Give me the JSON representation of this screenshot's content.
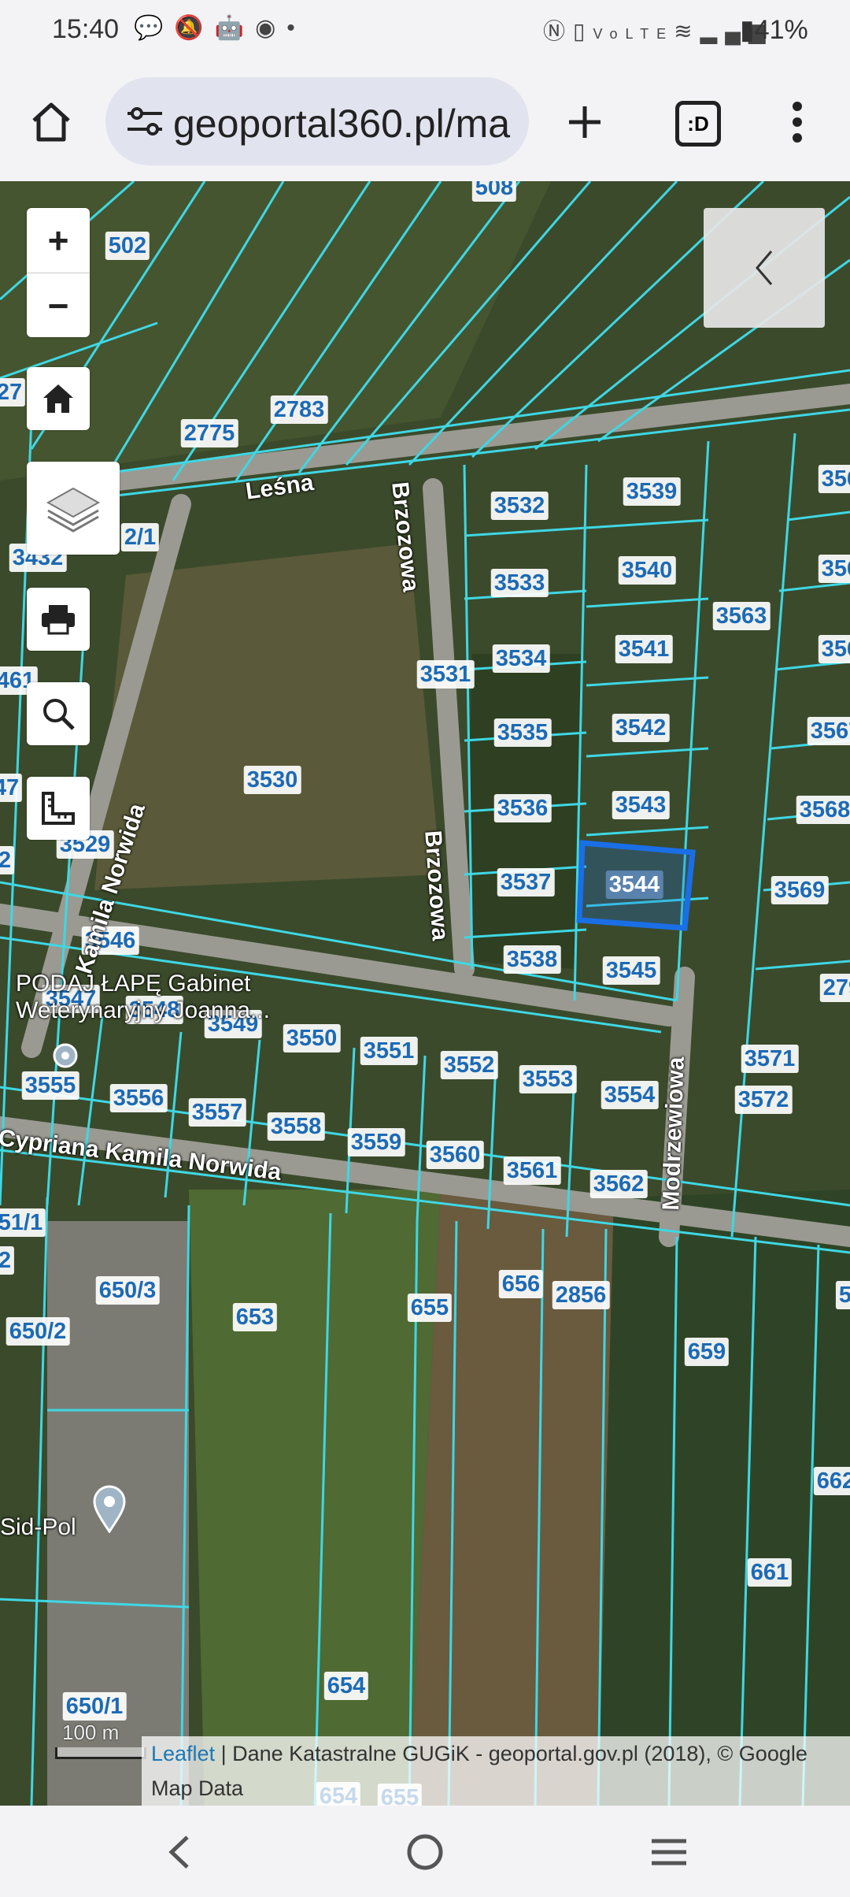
{
  "status": {
    "time": "15:40",
    "left_icons": [
      "chat-icon",
      "bell-off-icon",
      "android-icon",
      "chrome-icon",
      "dot-icon"
    ],
    "right_icons": [
      "nfc-icon",
      "vibrate-icon",
      "volte-icon",
      "wifi-icon",
      "signal-icon"
    ],
    "battery": "41%"
  },
  "browser": {
    "url": "geoportal360.pl/ma",
    "tab_label": ":D"
  },
  "map": {
    "colors": {
      "parcel_line": "#3fd7e4",
      "selected": "#1a6fe6",
      "label_text": "#1d6ab5"
    },
    "selected_parcel": "3544",
    "parcels": [
      {
        "id": "508"
      },
      {
        "id": "502"
      },
      {
        "id": "27"
      },
      {
        "id": "2783"
      },
      {
        "id": "2775"
      },
      {
        "id": "2/1"
      },
      {
        "id": "3432"
      },
      {
        "id": "3532"
      },
      {
        "id": "3539"
      },
      {
        "id": "3533"
      },
      {
        "id": "3540"
      },
      {
        "id": "3563"
      },
      {
        "id": "3534"
      },
      {
        "id": "3541"
      },
      {
        "id": "3531"
      },
      {
        "id": "3535"
      },
      {
        "id": "3542"
      },
      {
        "id": "3530"
      },
      {
        "id": "3536"
      },
      {
        "id": "3543"
      },
      {
        "id": "3537"
      },
      {
        "id": "3544"
      },
      {
        "id": "3569"
      },
      {
        "id": "3529"
      },
      {
        "id": "3538"
      },
      {
        "id": "3545"
      },
      {
        "id": "3546"
      },
      {
        "id": "3547"
      },
      {
        "id": "3548"
      },
      {
        "id": "3549"
      },
      {
        "id": "3550"
      },
      {
        "id": "3551"
      },
      {
        "id": "3552"
      },
      {
        "id": "3553"
      },
      {
        "id": "3554"
      },
      {
        "id": "3571"
      },
      {
        "id": "3572"
      },
      {
        "id": "3555"
      },
      {
        "id": "3556"
      },
      {
        "id": "3557"
      },
      {
        "id": "3558"
      },
      {
        "id": "3559"
      },
      {
        "id": "3560"
      },
      {
        "id": "3561"
      },
      {
        "id": "3562"
      },
      {
        "id": "51/1"
      },
      {
        "id": "650/3"
      },
      {
        "id": "653"
      },
      {
        "id": "655"
      },
      {
        "id": "656"
      },
      {
        "id": "2856"
      },
      {
        "id": "650/2"
      },
      {
        "id": "659"
      },
      {
        "id": "662"
      },
      {
        "id": "661"
      },
      {
        "id": "654"
      },
      {
        "id": "650/1"
      },
      {
        "id": "655"
      },
      {
        "id": "654"
      },
      {
        "id": "356"
      },
      {
        "id": "356"
      },
      {
        "id": "356"
      },
      {
        "id": "3567"
      },
      {
        "id": "3568"
      },
      {
        "id": "279"
      },
      {
        "id": "461"
      },
      {
        "id": "47"
      },
      {
        "id": "2"
      },
      {
        "id": "2"
      },
      {
        "id": "5"
      }
    ],
    "streets": [
      "Leśna",
      "Brzozowa",
      "Brzozowa",
      "Kamila Norwida",
      "Cypriana Kamila Norwida",
      "Modrzewiowa"
    ],
    "pois": [
      "PODAJ ŁAPĘ Gabinet Weterynaryjny Joanna...",
      "Sid-Pol"
    ],
    "scale_label": "100 m",
    "attribution": {
      "leaflet": "Leaflet",
      "text": " | Dane Katastralne GUGiK - geoportal.gov.pl (2018), © Google Map Data"
    }
  }
}
